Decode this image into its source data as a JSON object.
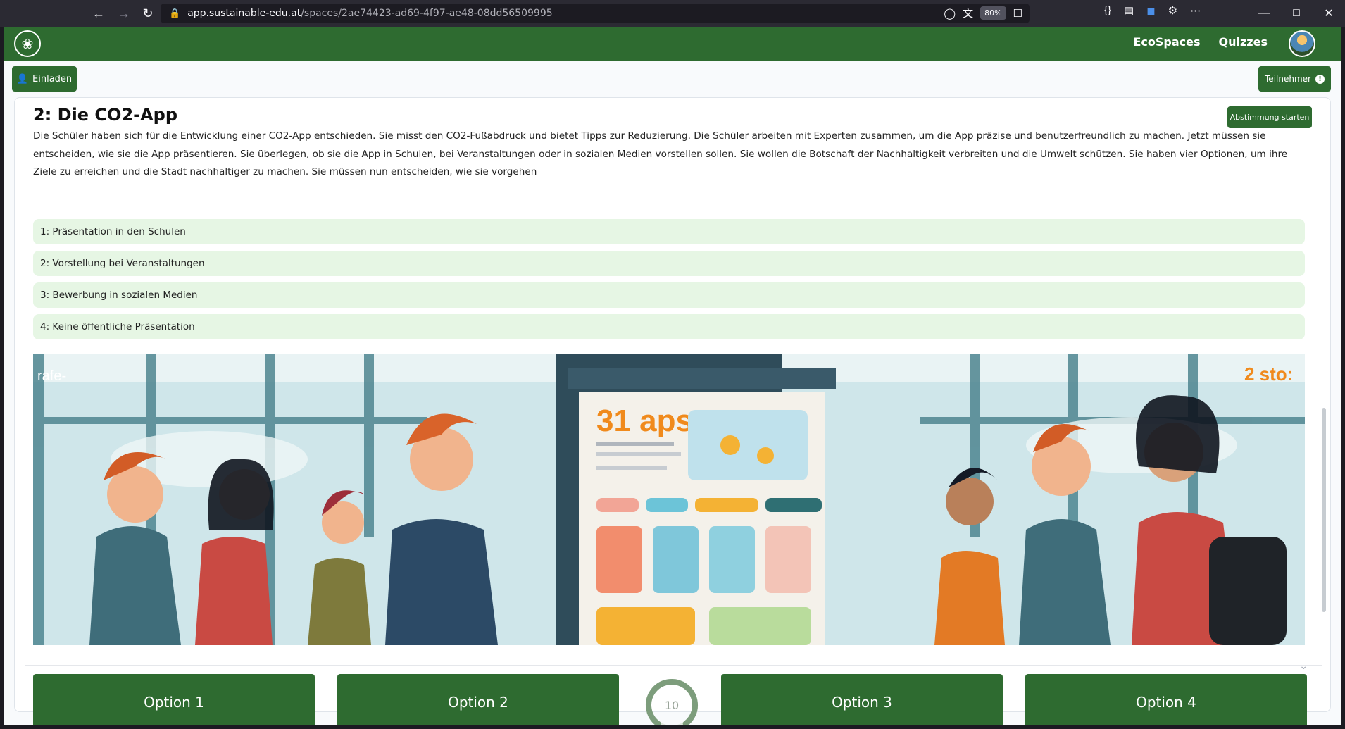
{
  "browser": {
    "url_host": "app.sustainable-edu.at",
    "url_path": "/spaces/2ae74423-ad69-4f97-ae48-08dd56509995",
    "zoom": "80%"
  },
  "header": {
    "nav": [
      "EcoSpaces",
      "Quizzes"
    ]
  },
  "toolbar": {
    "invite_label": "Einladen",
    "participants_label": "Teilnehmer"
  },
  "card": {
    "title": "2: Die CO2-App",
    "start_vote_label": "Abstimmung starten",
    "description": "Die Schüler haben sich für die Entwicklung einer CO2-App entschieden. Sie misst den CO2-Fußabdruck und bietet Tipps zur Reduzierung. Die Schüler arbeiten mit Experten zusammen, um die App präzise und benutzerfreundlich zu machen. Jetzt müssen sie entscheiden, wie sie die App präsentieren. Sie überlegen, ob sie die App in Schulen, bei Veranstaltungen oder in sozialen Medien vorstellen sollen. Sie wollen die Botschaft der Nachhaltigkeit verbreiten und die Umwelt schützen. Sie haben vier Optionen, um ihre Ziele zu erreichen und die Stadt nachhaltiger zu machen. Sie müssen nun entscheiden, wie sie vorgehen",
    "options": [
      "1: Präsentation in den Schulen",
      "2: Vorstellung bei Veranstaltungen",
      "3: Bewerbung in sozialen Medien",
      "4: Keine öffentliche Präsentation"
    ]
  },
  "illustration": {
    "poster_heading": "31 aps",
    "corner_left": "rafe-",
    "corner_right": "2 sto:"
  },
  "vote": {
    "buttons": [
      "Option 1",
      "Option 2",
      "Option 3",
      "Option 4"
    ],
    "timer": "10",
    "timer_fraction": 0.8
  },
  "colors": {
    "brand_green": "#2e6b30",
    "option_bg": "#e6f6e4"
  }
}
